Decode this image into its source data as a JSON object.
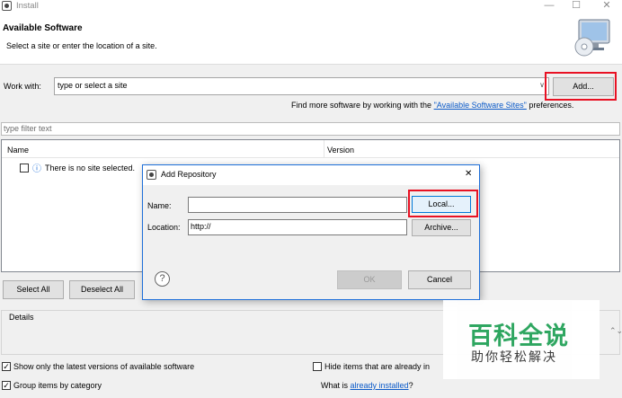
{
  "window": {
    "title": "Install",
    "minimize": "—",
    "maximize": "☐",
    "close": "✕"
  },
  "header": {
    "title": "Available Software",
    "description": "Select a site or enter the location of a site."
  },
  "work_with": {
    "label": "Work with:",
    "value": "type or select a site",
    "dropdown_arrow": "∨",
    "add_button": "Add...",
    "find_more_prefix": "Find more software by working with the ",
    "find_more_link": "\"Available Software Sites\"",
    "find_more_suffix": " preferences."
  },
  "filter": {
    "placeholder": "type filter text"
  },
  "tree": {
    "columns": [
      "Name",
      "Version"
    ],
    "rows": [
      {
        "checked": false,
        "icon": "info-icon",
        "icon_glyph": "ⓘ",
        "text": "There is no site selected."
      }
    ]
  },
  "buttons": {
    "select_all": "Select All",
    "deselect_all": "Deselect All"
  },
  "details": {
    "label": "Details",
    "spinner": "⌃⌄"
  },
  "options": [
    {
      "checked": true,
      "label": "Show only the latest versions of available software"
    },
    {
      "checked": true,
      "label": "Group items by category"
    },
    {
      "checked": false,
      "label": "Hide items that are already in"
    }
  ],
  "already_installed": {
    "prefix": "What is ",
    "link": "already installed",
    "suffix": "?"
  },
  "dialog": {
    "title": "Add Repository",
    "close": "✕",
    "name_label": "Name:",
    "name_value": "",
    "location_label": "Location:",
    "location_value": "http://",
    "local_button": "Local...",
    "archive_button": "Archive...",
    "help_glyph": "?",
    "ok_button": "OK",
    "cancel_button": "Cancel"
  },
  "watermark": {
    "main": "百科全说",
    "sub": "助你轻松解决"
  },
  "colors": {
    "highlight": "#e81123",
    "link": "#0b5ac8",
    "dialog_border": "#1e6fd9",
    "watermark_green": "#27a35b"
  }
}
